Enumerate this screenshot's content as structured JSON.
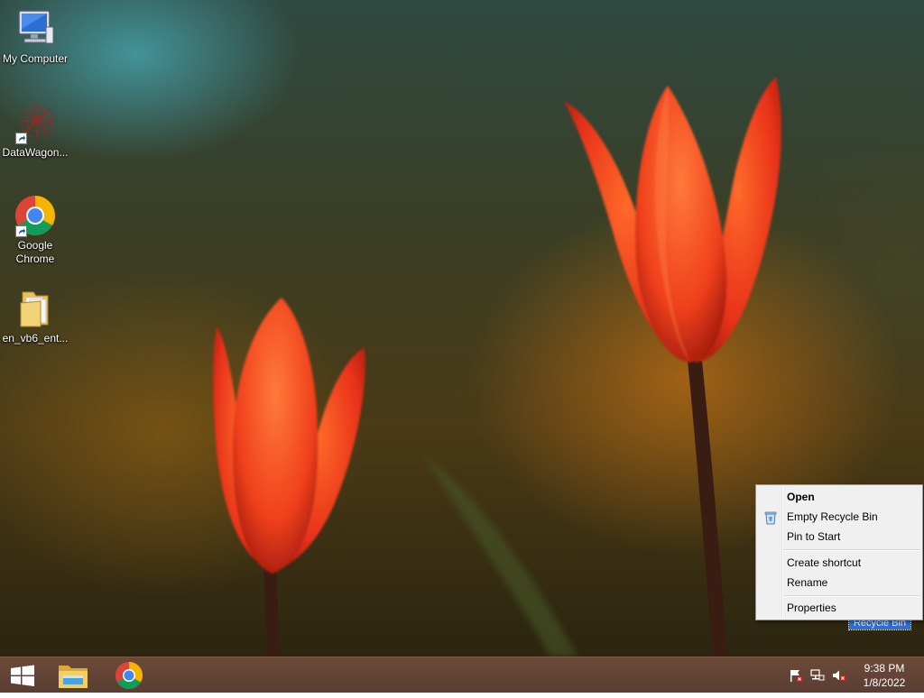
{
  "desktop_icons": [
    {
      "label": "My Computer"
    },
    {
      "label": "DataWagon..."
    },
    {
      "label": "Google Chrome"
    },
    {
      "label": "en_vb6_ent..."
    }
  ],
  "recycle_bin_label": "Recycle Bin",
  "context_menu": {
    "items": [
      {
        "label": "Open"
      },
      {
        "label": "Empty Recycle Bin"
      },
      {
        "label": "Pin to Start"
      },
      {
        "label": "Create shortcut"
      },
      {
        "label": "Rename"
      },
      {
        "label": "Properties"
      }
    ]
  },
  "taskbar": {
    "time": "9:38 PM",
    "date": "1/8/2022"
  },
  "colors": {
    "taskbar": "#5b3e31",
    "menu_bg": "#f0f0f0",
    "selection": "#2f6fcf"
  }
}
